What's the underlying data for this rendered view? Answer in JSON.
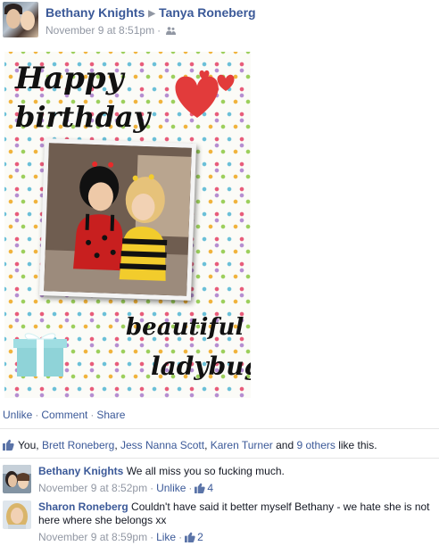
{
  "post": {
    "author": "Bethany Knights",
    "target": "Tanya Roneberg",
    "timestamp": "November 9 at 8:51pm",
    "audience_icon": "friends-icon"
  },
  "card": {
    "line1": "Happy",
    "line2": "birthday",
    "line3": "beautiful",
    "line4": "ladybug!"
  },
  "actions": {
    "unlike": "Unlike",
    "comment": "Comment",
    "share": "Share"
  },
  "likes": {
    "you": "You,",
    "names": [
      "Brett Roneberg",
      "Jess Nanna Scott",
      "Karen Turner"
    ],
    "and": "and",
    "others": "9 others",
    "suffix": "like this."
  },
  "comments": [
    {
      "author": "Bethany Knights",
      "text": "We all miss you so fucking much.",
      "timestamp": "November 9 at 8:52pm",
      "action": "Unlike",
      "like_count": "4"
    },
    {
      "author": "Sharon Roneberg",
      "text": "Couldn't have said it better myself Bethany - we hate she is not here where she belongs xx",
      "timestamp": "November 9 at 8:59pm",
      "action": "Like",
      "like_count": "2"
    }
  ],
  "colors": {
    "link": "#3b5998",
    "meta": "#9197a3",
    "text": "#141823"
  }
}
